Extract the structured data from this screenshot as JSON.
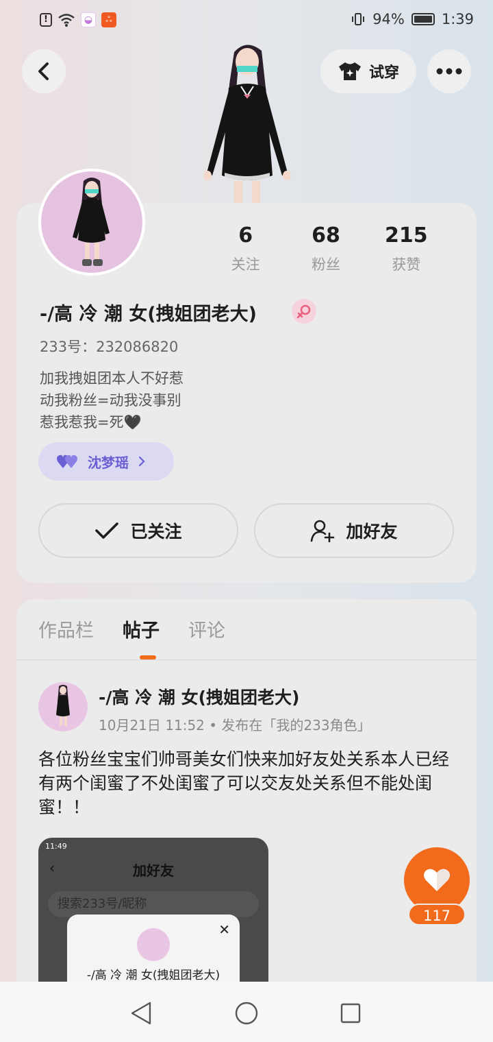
{
  "status_bar": {
    "battery": "94%",
    "time": "1:39"
  },
  "header": {
    "tryon_label": "试穿"
  },
  "profile": {
    "nickname": "-/高 冷 潮 女(拽姐团老大)",
    "id_line": "233号：232086820",
    "bio": [
      "加我拽姐团本人不好惹",
      "动我粉丝=动我没事别",
      "惹我惹我=死🖤"
    ],
    "stats": [
      {
        "value": "6",
        "label": "关注"
      },
      {
        "value": "68",
        "label": "粉丝"
      },
      {
        "value": "215",
        "label": "获赞"
      }
    ],
    "cp_name": "沈梦瑶",
    "follow_label": "已关注",
    "add_friend_label": "加好友"
  },
  "tabs": [
    "作品栏",
    "帖子",
    "评论"
  ],
  "active_tab": "帖子",
  "post": {
    "author": "-/高 冷 潮 女(拽姐团老大)",
    "meta": "10月21日 11:52 • 发布在「我的233角色」",
    "text": "各位粉丝宝宝们帅哥美女们快来加好友处关系本人已经有两个闺蜜了不处闺蜜了可以交友处关系但不能处闺蜜！！",
    "image": {
      "time": "11:49",
      "title": "加好友",
      "search_placeholder": "搜索233号/昵称",
      "popup_name": "-/高 冷 潮 女(拽姐团老大)"
    }
  },
  "like_count": "117",
  "colors": {
    "accent": "#f26a1b",
    "cp_tag_bg": "#dcdaf2",
    "cp_tag_text": "#6a5fd3",
    "gender_badge": "#f6d2dc"
  }
}
